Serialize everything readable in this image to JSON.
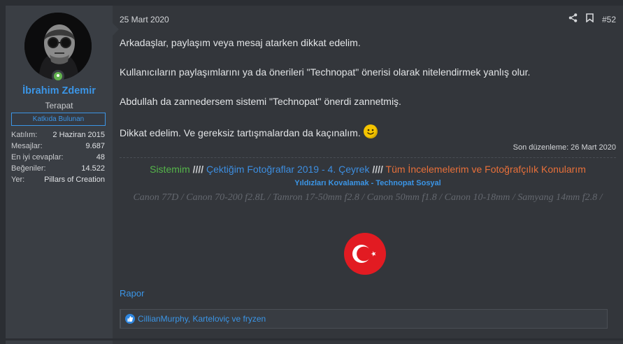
{
  "user": {
    "name": "İbrahim Zdemir",
    "title": "Terapat",
    "banner": "Katkıda Bulunan",
    "stats": [
      {
        "label": "Katılım:",
        "value": "2 Haziran 2015"
      },
      {
        "label": "Mesajlar:",
        "value": "9.687"
      },
      {
        "label": "En iyi cevaplar:",
        "value": "48"
      },
      {
        "label": "Beğeniler:",
        "value": "14.522"
      },
      {
        "label": "Yer:",
        "value": "Pillars of Creation"
      }
    ]
  },
  "post": {
    "date": "25 Mart 2020",
    "number": "#52",
    "paragraphs": [
      "Arkadaşlar, paylaşım veya mesaj atarken dikkat edelim.",
      "Kullanıcıların paylaşımlarını ya da önerileri \"Technopat\" önerisi olarak nitelendirmek yanlış olur.",
      "Abdullah da zannedersem sistemi \"Technopat\" önerdi zannetmiş.",
      "Dikkat edelim. Ve gereksiz tartışmalardan da kaçınalım."
    ],
    "edited": "Son düzenleme: 26 Mart 2020"
  },
  "signature": {
    "link1": "Sistemim",
    "sep": "////",
    "link2": "Çektiğim Fotoğraflar 2019 - 4. Çeyrek",
    "link3": "Tüm İncelemelerim ve Fotoğrafçılık Konularım",
    "line2": "Yıldızları Kovalamak - Technopat Sosyal",
    "gear": "Canon 77D / Canon 70-200 f2.8L / Tamron 17-50mm f2.8 / Canon 50mm f1.8 / Canon 10-18mm / Samyang 14mm f2.8 /"
  },
  "footer": {
    "report": "Rapor",
    "reactions": "CillianMurphy, Karteloviç ve fryzen"
  },
  "colors": {
    "accent": "#3b95e6",
    "green": "#55b54a",
    "orange": "#e8703a",
    "flag_red": "#e21b22"
  },
  "icons": [
    "share-icon",
    "bookmark-icon",
    "smiley-icon",
    "like-icon",
    "turkish-flag-icon",
    "online-status-icon"
  ]
}
